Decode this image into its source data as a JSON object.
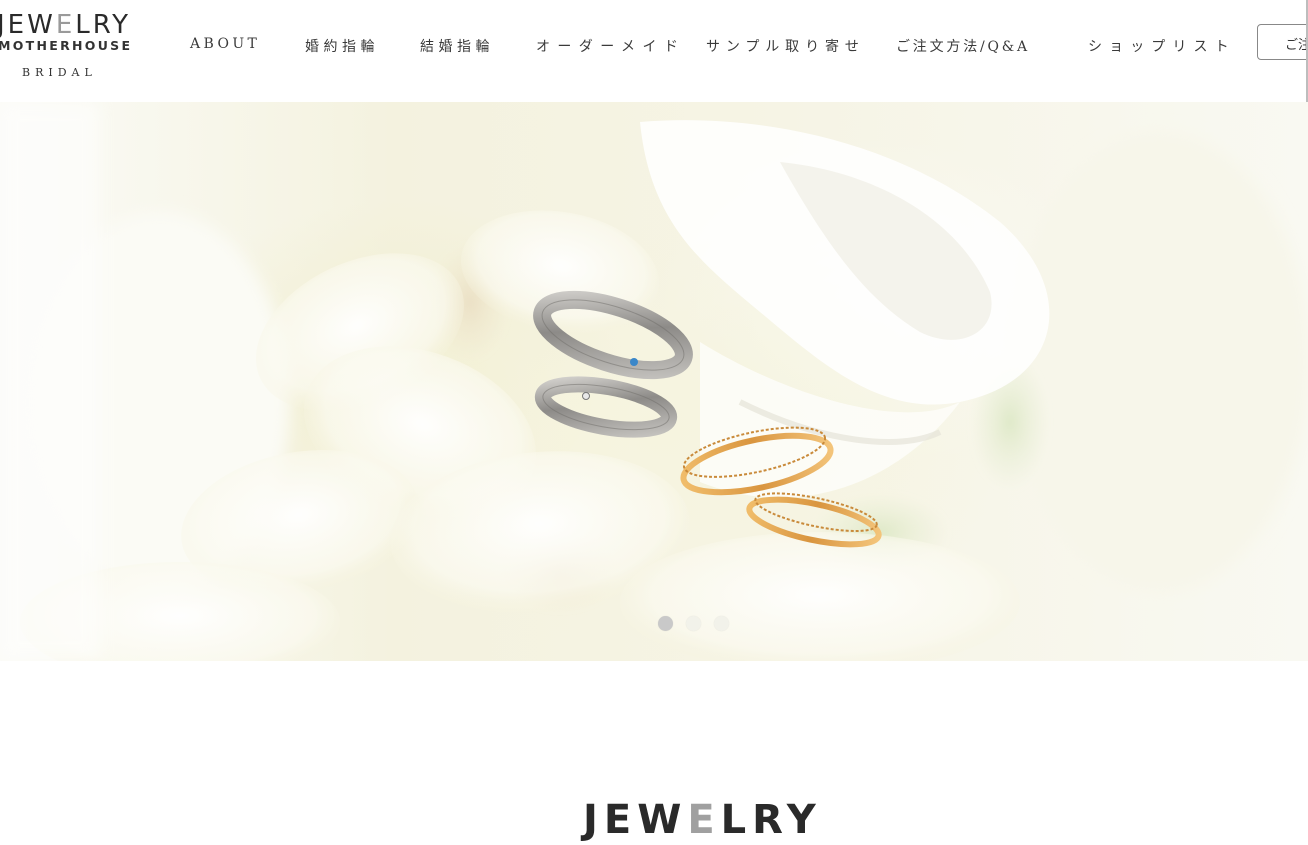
{
  "brand": {
    "logo_word_prefix": "JEW",
    "logo_word_light": "E",
    "logo_word_suffix": "LRY",
    "logo_subtitle": "MOTHERHOUSE",
    "logo_tagline": "BRIDAL"
  },
  "nav": {
    "items": [
      {
        "label": "ABOUT"
      },
      {
        "label": "婚約指輪"
      },
      {
        "label": "結婚指輪"
      },
      {
        "label": "オーダーメイド"
      },
      {
        "label": "サンプル取り寄せ"
      },
      {
        "label": "ご注文方法/Q&A"
      },
      {
        "label": "ショップリスト"
      }
    ],
    "cta_label": "ご注"
  },
  "hero": {
    "slide_count": 3,
    "active_slide": 1
  },
  "section": {
    "heading_prefix": "JEW",
    "heading_light": "E",
    "heading_suffix": "LRY"
  },
  "colors": {
    "text": "#333333",
    "accent_gray": "#9a9a9a",
    "silver": "#a8a6a2",
    "gold": "#e2a955"
  },
  "icons": [
    "hero-rings-image",
    "carousel-dot"
  ]
}
